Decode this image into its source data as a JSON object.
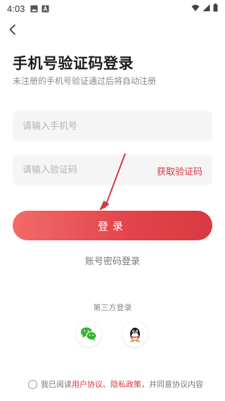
{
  "status_bar": {
    "time": "4:03"
  },
  "header": {
    "title": "手机号验证码登录",
    "subtitle": "未注册的手机号验证通过后将自动注册"
  },
  "form": {
    "phone_placeholder": "请输入手机号",
    "code_placeholder": "请输入验证码",
    "get_code_label": "获取验证码",
    "login_label": "登录",
    "password_login_label": "账号密码登录"
  },
  "third_party": {
    "label": "第三方登录",
    "providers": [
      "wechat-icon",
      "qq-icon"
    ]
  },
  "agreement": {
    "prefix": "我已阅读",
    "user_agreement": "用户协议、",
    "privacy_policy": "隐私政策",
    "suffix": "，并同意协议内容"
  },
  "colors": {
    "accent": "#d9363e",
    "button_gradient_start": "#f26a6a",
    "button_gradient_end": "#d93a40",
    "wechat": "#35b431",
    "annotation_arrow": "#d9363e"
  }
}
